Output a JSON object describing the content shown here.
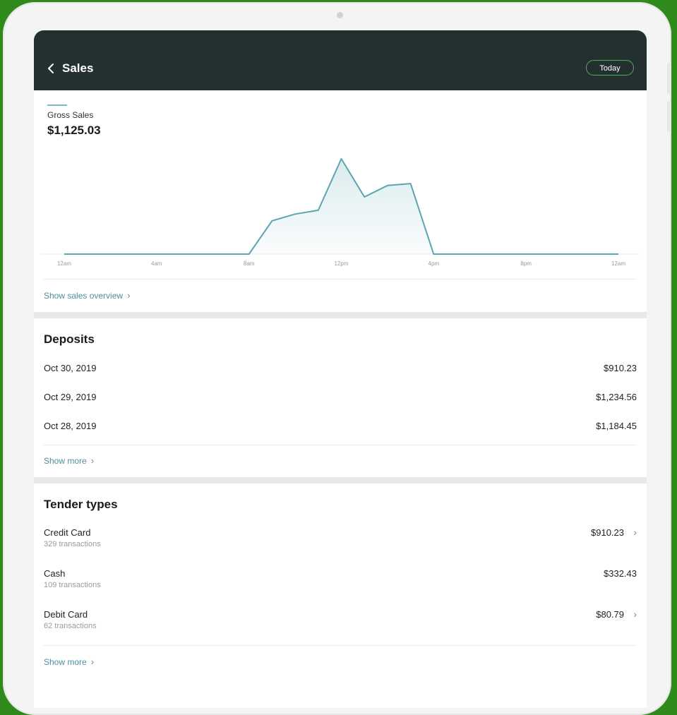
{
  "header": {
    "title": "Sales",
    "period_button": "Today"
  },
  "gross_sales": {
    "label": "Gross Sales",
    "value": "$1,125.03"
  },
  "chart_data": {
    "type": "area",
    "x_ticks": [
      "12am",
      "4am",
      "8am",
      "12pm",
      "4pm",
      "8pm",
      "12am"
    ],
    "x": [
      0,
      4,
      8,
      9,
      10,
      11,
      12,
      13,
      14,
      15,
      16,
      20,
      24
    ],
    "y": [
      0,
      0,
      0,
      35,
      42,
      46,
      100,
      60,
      72,
      74,
      0,
      0,
      0
    ],
    "series_color": "#5aa5b1"
  },
  "links": {
    "sales_overview": "Show sales overview",
    "deposits_more": "Show more",
    "tenders_more": "Show more"
  },
  "deposits": {
    "title": "Deposits",
    "rows": [
      {
        "date": "Oct 30, 2019",
        "amount": "$910.23"
      },
      {
        "date": "Oct 29, 2019",
        "amount": "$1,234.56"
      },
      {
        "date": "Oct 28, 2019",
        "amount": "$1,184.45"
      }
    ]
  },
  "tender_types": {
    "title": "Tender types",
    "rows": [
      {
        "name": "Credit Card",
        "count": "329 transactions",
        "amount": "$910.23"
      },
      {
        "name": "Cash",
        "count": "109 transactions",
        "amount": "$332.43"
      },
      {
        "name": "Debit Card",
        "count": "62 transactions",
        "amount": "$80.79"
      }
    ]
  },
  "colors": {
    "header_bg": "#23302f",
    "accent_link": "#4d8fa0",
    "today_border": "#4caf50",
    "frame_bg": "#2f8a1c"
  }
}
